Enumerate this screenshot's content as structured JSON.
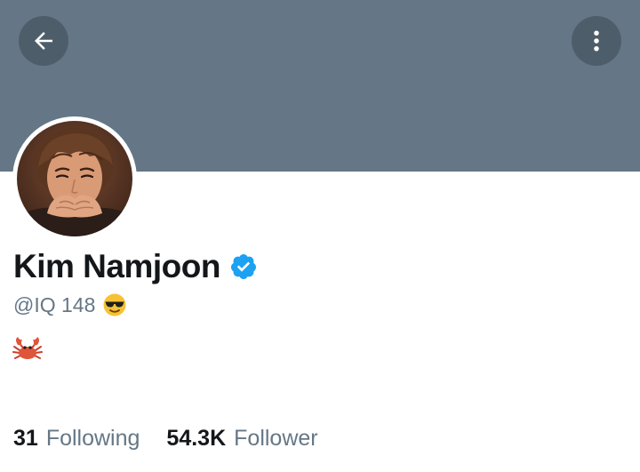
{
  "profile": {
    "display_name": "Kim Namjoon",
    "handle": "@IQ 148",
    "verified": true,
    "handle_emoji": "smiling-face-with-sunglasses",
    "bio_emoji": "crab"
  },
  "stats": {
    "following_count": "31",
    "following_label": "Following",
    "follower_count": "54.3K",
    "follower_label": "Follower"
  },
  "icons": {
    "back": "arrow-left-icon",
    "more": "more-vertical-icon",
    "verified": "verified-badge-icon"
  },
  "colors": {
    "banner": "#657786",
    "verified_badge": "#1da1f2",
    "primary_text": "#14171a",
    "secondary_text": "#657786"
  }
}
